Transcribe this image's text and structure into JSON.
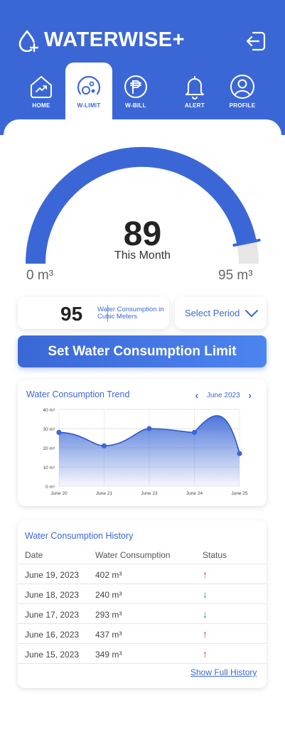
{
  "app": {
    "title": "WATERWISE+",
    "brand_color": "#3b67d6"
  },
  "tabs": [
    {
      "label": "HOME",
      "icon": "home-chart-icon",
      "active": false
    },
    {
      "label": "W-LIMIT",
      "icon": "gauge-icon",
      "active": true
    },
    {
      "label": "W-BILL",
      "icon": "peso-icon",
      "active": false
    },
    {
      "label": "ALERT",
      "icon": "bell-icon",
      "active": false
    },
    {
      "label": "PROFILE",
      "icon": "user-icon",
      "active": false
    }
  ],
  "gauge": {
    "value": "89",
    "caption": "This Month",
    "min_label": "0 m³",
    "max_label": "95 m³",
    "min": 0,
    "max": 95,
    "current": 89
  },
  "usage": {
    "value": "95",
    "description": "Water Consumption in Cubic Meters"
  },
  "period": {
    "label": "Select Period"
  },
  "limit_button": {
    "label": "Set Water Consumption Limit"
  },
  "trend": {
    "title": "Water Consumption Trend",
    "month": "June 2023"
  },
  "chart_data": {
    "type": "area",
    "title": "Water Consumption Trend",
    "x": [
      "June 20",
      "June 21",
      "June 23",
      "June 24",
      "June 25"
    ],
    "series": [
      {
        "values": [
          28,
          21,
          30,
          28,
          17
        ]
      }
    ],
    "y_ticks": [
      "0 m³",
      "10 m³",
      "20 m³",
      "30 m³",
      "40 m³"
    ],
    "ylim": [
      0,
      40
    ],
    "grid": true
  },
  "history": {
    "title": "Water Consumption History",
    "columns": [
      "Date",
      "Water Consumption",
      "Status"
    ],
    "rows": [
      {
        "date": "June 19, 2023",
        "consumption": "402 m³",
        "status": "up"
      },
      {
        "date": "June 18, 2023",
        "consumption": "240 m³",
        "status": "down"
      },
      {
        "date": "June 17, 2023",
        "consumption": "293 m³",
        "status": "down"
      },
      {
        "date": "June 16, 2023",
        "consumption": "437 m³",
        "status": "up"
      },
      {
        "date": "June 15, 2023",
        "consumption": "349 m³",
        "status": "up"
      }
    ],
    "show_full_label": "Show Full History"
  }
}
